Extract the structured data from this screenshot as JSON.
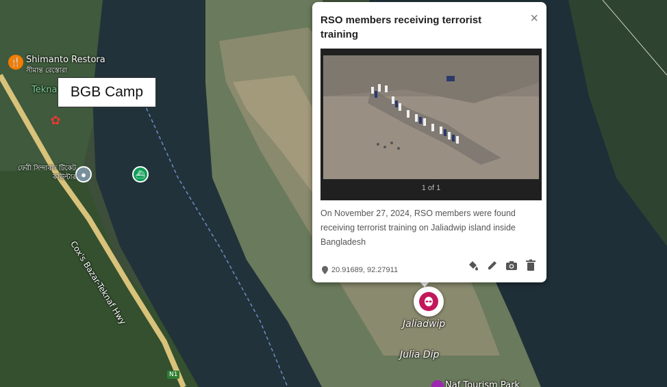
{
  "map": {
    "labels": {
      "restaurant": "Shimanto Restora",
      "restaurant_bn": "সীমান্ত রেস্তোরা",
      "teknaf": "Tekna",
      "teknaf_road": "Teknaf Hwy",
      "road": "Cox's Bazar-Teknaf Hwy",
      "ferry": "ফেরী সিন্দাবাদ টিকেট কাউন্টার",
      "jaliadwip": "Jaliadwip",
      "julia_dip": "Julia Dip",
      "naf_park": "Naf Tourism Park",
      "route_badge": "N1"
    },
    "callout": "BGB Camp"
  },
  "popup": {
    "title": "RSO members receiving terrorist training",
    "close_symbol": "×",
    "photo_counter": "1 of 1",
    "description": "On November 27, 2024, RSO members were found receiving terrorist training on Jaliadwip island inside Bangladesh",
    "coordinates": "20.91689, 92.27911",
    "tools": [
      "paint-bucket-icon",
      "pencil-icon",
      "camera-icon",
      "trash-icon"
    ]
  },
  "colors": {
    "marker": "#c2185b",
    "restaurant_poi": "#f57c00",
    "ferry_poi": "#0f9d58",
    "location_poi": "#78909c"
  }
}
